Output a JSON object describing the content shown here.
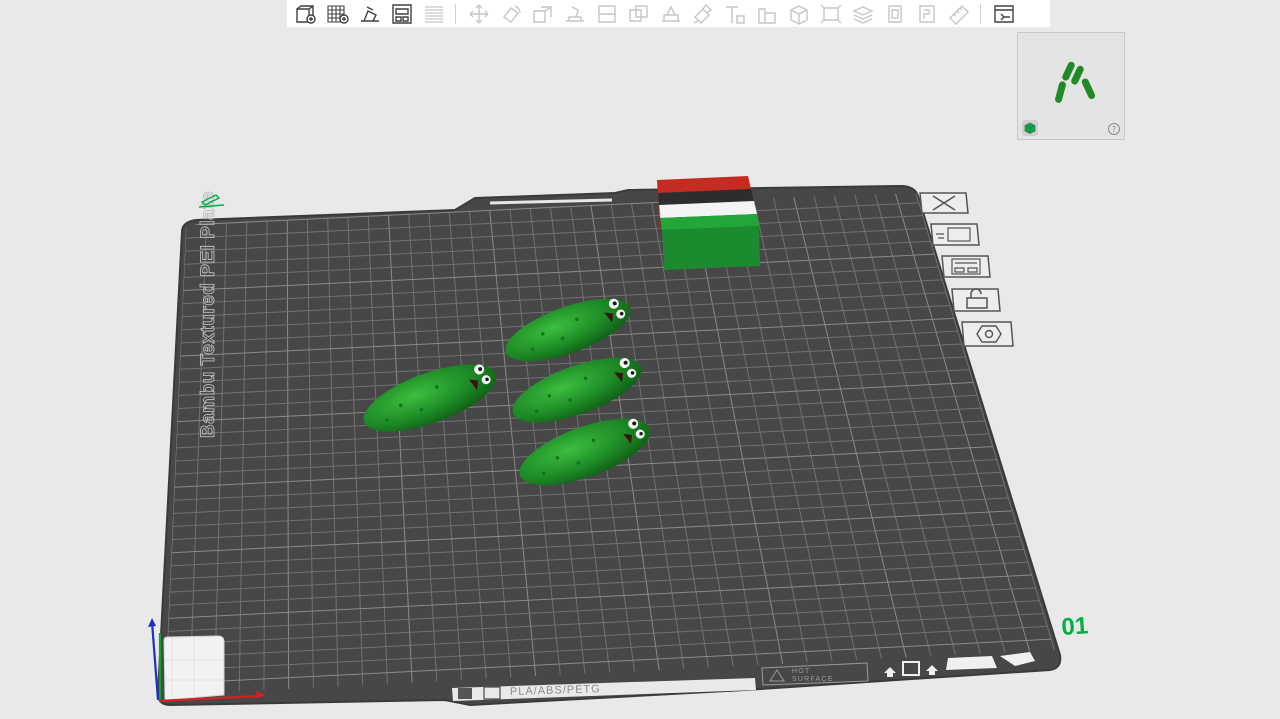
{
  "plate": {
    "label": "Bambu Textured PEI Plate",
    "number": "01",
    "filament_types": "PLA/ABS/PETG",
    "hot_surface": [
      "HOT",
      "SURFACE"
    ]
  },
  "toolbar": {
    "active": [
      "add-object-icon",
      "add-plate-icon",
      "auto-orient-icon",
      "arrange-icon",
      "split-objects-icon"
    ],
    "disabled": [
      "move-icon",
      "rotate-icon",
      "scale-icon",
      "lay-on-face-icon",
      "cut-icon",
      "boolean-icon",
      "support-paint-icon",
      "seam-paint-icon",
      "color-paint-icon",
      "text-icon",
      "emboss-icon",
      "measure-icon",
      "assembly-icon",
      "layers-icon",
      "brim-icon",
      "flatten-icon",
      "mesh-icon",
      "ruler-icon"
    ],
    "right": "view-toggle-icon"
  },
  "side_buttons": [
    "close-icon",
    "place-on-plate-icon",
    "arrange-plate-icon",
    "lock-icon",
    "settings-hex-icon"
  ],
  "colors": {
    "plate": "#4a4a4a",
    "grid": "#6e6e6e",
    "pickle": "#1e8a26",
    "accent_green": "#00ae42",
    "axis_x": "#d42020",
    "axis_y": "#16a02c",
    "axis_z": "#1e2fc8"
  }
}
